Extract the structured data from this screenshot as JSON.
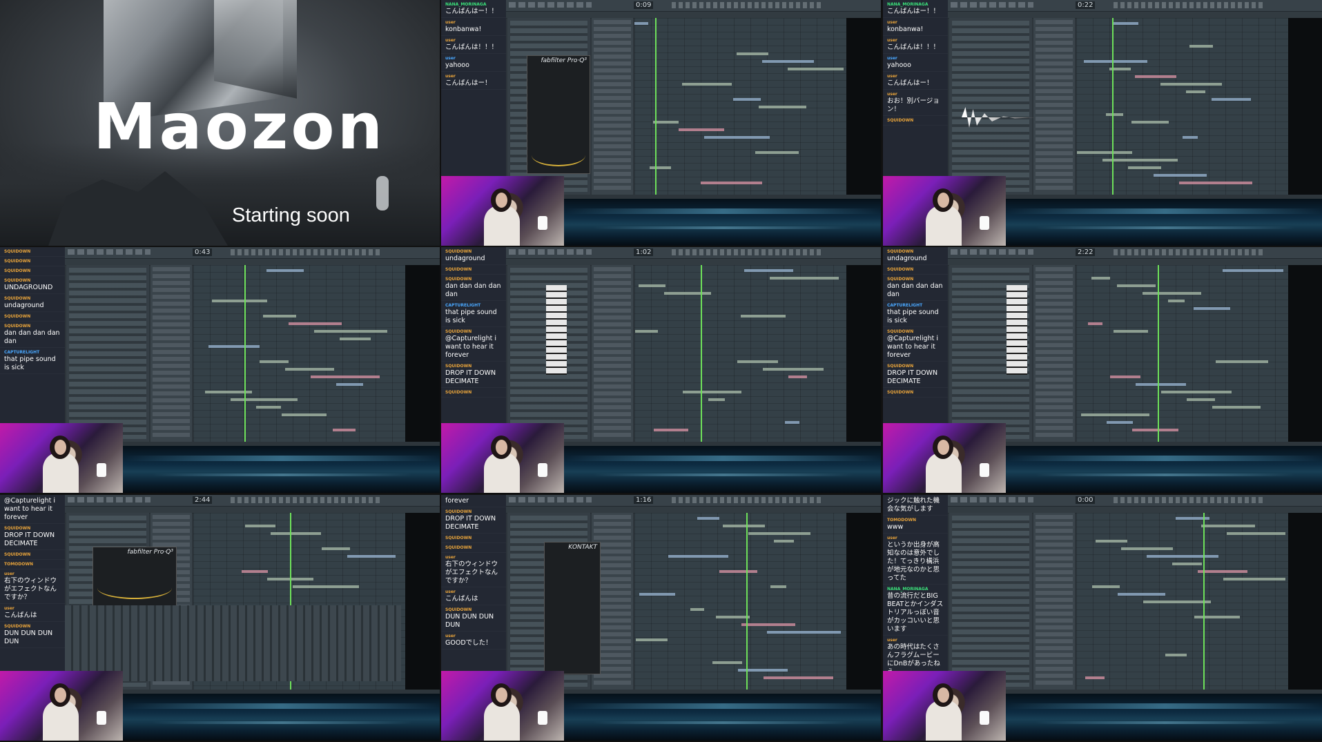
{
  "title_card": {
    "logo": "Maozon",
    "status": "Starting soon"
  },
  "tiles": [
    {
      "id": "tile-2",
      "time": "0:09",
      "chat": [
        {
          "user": "NANA_MORINAGA",
          "user_color": "green",
          "text": "こんばんはー！！"
        },
        {
          "user": "user",
          "user_color": "orange",
          "text": "konbanwa!"
        },
        {
          "user": "user",
          "user_color": "orange",
          "text": "こんばんは！！！"
        },
        {
          "user": "user",
          "user_color": "blue",
          "text": "yahooo"
        },
        {
          "user": "user",
          "user_color": "orange",
          "text": "こんばんはー！"
        }
      ],
      "plugin": "fabfilter Pro·Q³"
    },
    {
      "id": "tile-3",
      "time": "0:22",
      "chat": [
        {
          "user": "NANA_MORINAGA",
          "user_color": "green",
          "text": "こんばんはー！！"
        },
        {
          "user": "user",
          "user_color": "orange",
          "text": "konbanwa!"
        },
        {
          "user": "user",
          "user_color": "orange",
          "text": "こんばんは！！！"
        },
        {
          "user": "user",
          "user_color": "blue",
          "text": "yahooo"
        },
        {
          "user": "user",
          "user_color": "orange",
          "text": "こんばんはー！"
        },
        {
          "user": "user",
          "user_color": "orange",
          "text": "おお！別バージョン！"
        },
        {
          "user": "SQUIDOWN",
          "user_color": "orange",
          "text": ""
        }
      ]
    },
    {
      "id": "tile-4",
      "time": "0:43",
      "chat": [
        {
          "user": "SQUIDOWN",
          "user_color": "orange",
          "text": ""
        },
        {
          "user": "SQUIDOWN",
          "user_color": "orange",
          "text": ""
        },
        {
          "user": "SQUIDOWN",
          "user_color": "orange",
          "text": ""
        },
        {
          "user": "SQUIDOWN",
          "user_color": "orange",
          "text": "UNDAGROUND"
        },
        {
          "user": "SQUIDOWN",
          "user_color": "orange",
          "text": "undaground"
        },
        {
          "user": "SQUIDOWN",
          "user_color": "orange",
          "text": ""
        },
        {
          "user": "SQUIDOWN",
          "user_color": "orange",
          "text": "dan dan dan dan dan"
        },
        {
          "user": "CAPTURELIGHT",
          "user_color": "blue",
          "text": "that pipe sound is sick"
        }
      ]
    },
    {
      "id": "tile-5",
      "time": "1:02",
      "chat": [
        {
          "user": "SQUIDOWN",
          "user_color": "orange",
          "text": "undaground"
        },
        {
          "user": "SQUIDOWN",
          "user_color": "orange",
          "text": ""
        },
        {
          "user": "SQUIDOWN",
          "user_color": "orange",
          "text": "dan dan dan dan dan"
        },
        {
          "user": "CAPTURELIGHT",
          "user_color": "blue",
          "text": "that pipe sound is sick"
        },
        {
          "user": "SQUIDOWN",
          "user_color": "orange",
          "text": "@Capturelight i want to hear it forever"
        },
        {
          "user": "SQUIDOWN",
          "user_color": "orange",
          "text": "DROP IT DOWN DECIMATE"
        },
        {
          "user": "SQUIDOWN",
          "user_color": "orange",
          "text": ""
        }
      ]
    },
    {
      "id": "tile-6",
      "time": "2:22",
      "chat": [
        {
          "user": "SQUIDOWN",
          "user_color": "orange",
          "text": "undaground"
        },
        {
          "user": "SQUIDOWN",
          "user_color": "orange",
          "text": ""
        },
        {
          "user": "SQUIDOWN",
          "user_color": "orange",
          "text": "dan dan dan dan dan"
        },
        {
          "user": "CAPTURELIGHT",
          "user_color": "blue",
          "text": "that pipe sound is sick"
        },
        {
          "user": "SQUIDOWN",
          "user_color": "orange",
          "text": "@Capturelight i want to hear it forever"
        },
        {
          "user": "SQUIDOWN",
          "user_color": "orange",
          "text": "DROP IT DOWN DECIMATE"
        },
        {
          "user": "SQUIDOWN",
          "user_color": "orange",
          "text": ""
        }
      ]
    },
    {
      "id": "tile-7",
      "time": "2:44",
      "chat": [
        {
          "user": "",
          "user_color": "orange",
          "text": "@Capturelight i want to hear it forever"
        },
        {
          "user": "SQUIDOWN",
          "user_color": "orange",
          "text": "DROP IT DOWN DECIMATE"
        },
        {
          "user": "SQUIDOWN",
          "user_color": "orange",
          "text": ""
        },
        {
          "user": "TOMODOWN",
          "user_color": "orange",
          "text": ""
        },
        {
          "user": "user",
          "user_color": "orange",
          "text": "右下のウィンドウがエフェクトなんですか？"
        },
        {
          "user": "user",
          "user_color": "orange",
          "text": "こんばんは"
        },
        {
          "user": "SQUIDOWN",
          "user_color": "orange",
          "text": "DUN DUN DUN DUN"
        }
      ],
      "plugin": "fabfilter Pro·Q³"
    },
    {
      "id": "tile-8",
      "time": "1:16",
      "chat": [
        {
          "user": "",
          "user_color": "orange",
          "text": "forever"
        },
        {
          "user": "SQUIDOWN",
          "user_color": "orange",
          "text": "DROP IT DOWN DECIMATE"
        },
        {
          "user": "SQUIDOWN",
          "user_color": "orange",
          "text": ""
        },
        {
          "user": "SQUIDOWN",
          "user_color": "orange",
          "text": ""
        },
        {
          "user": "user",
          "user_color": "orange",
          "text": "右下のウィンドウがエフェクトなんですか？"
        },
        {
          "user": "user",
          "user_color": "orange",
          "text": "こんばんは"
        },
        {
          "user": "SQUIDOWN",
          "user_color": "orange",
          "text": "DUN DUN DUN DUN"
        },
        {
          "user": "user",
          "user_color": "orange",
          "text": "GOODでした！"
        }
      ],
      "plugin": "KONTAKT"
    },
    {
      "id": "tile-9",
      "time": "0:00",
      "chat": [
        {
          "user": "",
          "user_color": "orange",
          "text": "ジックに触れた機会な気がします"
        },
        {
          "user": "TOMODOWN",
          "user_color": "orange",
          "text": "www"
        },
        {
          "user": "user",
          "user_color": "orange",
          "text": "というか出身が高知なのは意外でした！てっきり構浜が地元なのかと思ってた"
        },
        {
          "user": "NANA_MORINAGA",
          "user_color": "green",
          "text": "昔の流行だとBIG BEATとかインダストリアルっぽい音がカッコいいと思います"
        },
        {
          "user": "user",
          "user_color": "orange",
          "text": "あの時代はたくさんフラグムービーにDnBがあったねえ"
        }
      ]
    }
  ],
  "colors": {
    "user_orange": "#e8a43b",
    "user_green": "#3be07a",
    "user_blue": "#4aa8ff",
    "playhead": "#6ee05a",
    "webcam_magenta": "#c21aa8"
  },
  "icons": [
    "fl-studio-toolbar-icons",
    "playhead-marker"
  ]
}
